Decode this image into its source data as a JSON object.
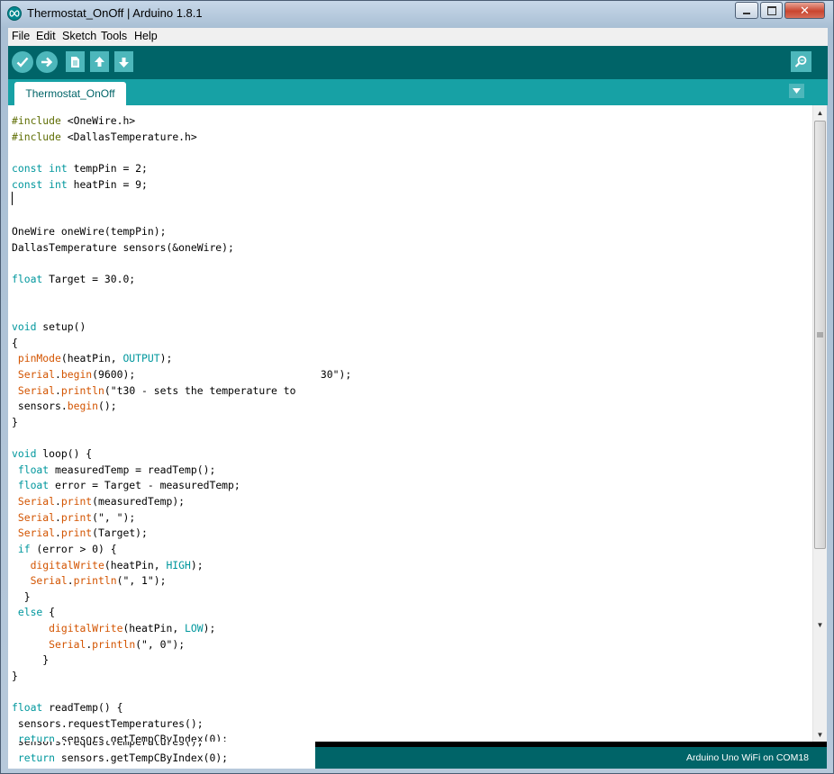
{
  "window": {
    "title": "Thermostat_OnOff | Arduino 1.8.1",
    "icon": "arduino-infinity-icon",
    "controls": {
      "minimize": "minimize-icon",
      "maximize": "maximize-icon",
      "close": "close-icon"
    }
  },
  "menu": [
    "File",
    "Edit",
    "Sketch",
    "Tools",
    "Help"
  ],
  "toolbar": {
    "buttons": [
      "verify-icon",
      "upload-icon",
      "new-icon",
      "open-icon",
      "save-icon"
    ],
    "serial_monitor": "serial-monitor-icon"
  },
  "tabs": [
    {
      "label": "Thermostat_OnOff"
    }
  ],
  "code": {
    "lines": [
      "#include <OneWire.h>",
      "#include <DallasTemperature.h>",
      "",
      "const int tempPin = 2;",
      "const int heatPin = 9;",
      "",
      "",
      "OneWire oneWire(tempPin);",
      "DallasTemperature sensors(&oneWire);",
      "",
      "float Target = 30.0;",
      "",
      "",
      "void setup()",
      "{",
      " pinMode(heatPin, OUTPUT);",
      " Serial.begin(9600);                              30\");",
      " Serial.println(\"t30 - sets the temperature to",
      " sensors.begin();",
      "}",
      "",
      "void loop() {",
      " float measuredTemp = readTemp();",
      " float error = Target - measuredTemp;",
      " Serial.print(measuredTemp);",
      " Serial.print(\", \");",
      " Serial.print(Target);",
      " if (error > 0) {",
      "   digitalWrite(heatPin, HIGH);",
      "   Serial.println(\", 1\");",
      "  }",
      " else {",
      "      digitalWrite(heatPin, LOW);",
      "      Serial.println(\", 0\");",
      "     }",
      "}",
      "",
      "float readTemp() {",
      " sensors.requestTemperatures();",
      " return sensors.getTempCByIndex(0);",
      "}"
    ]
  },
  "status": {
    "board": "Arduino Uno WiFi on COM18"
  },
  "colors": {
    "toolbar": "#006468",
    "tabstrip": "#17a1a5",
    "button": "#4db7bb",
    "keyword": "#00979d",
    "function": "#d35400",
    "preprocessor": "#5e6d03"
  }
}
